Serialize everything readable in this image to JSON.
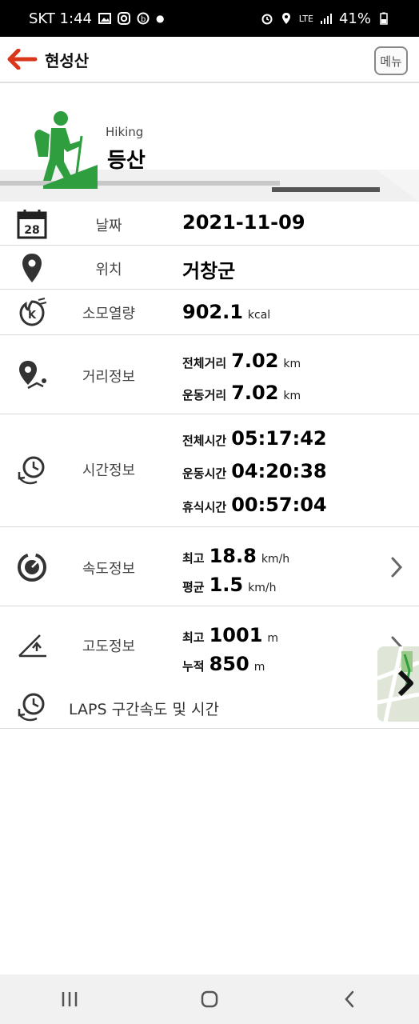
{
  "status": {
    "carrier_time": "SKT 1:44",
    "network": "LTE",
    "battery": "41%"
  },
  "appbar": {
    "title": "현성산",
    "menu_label": "메뉴"
  },
  "activity": {
    "subtitle": "Hiking",
    "title": "등산",
    "icon": "hiker-icon",
    "accent": "#2e9e3e"
  },
  "date": {
    "label": "날짜",
    "value": "2021-11-09",
    "icon_day": "28"
  },
  "location": {
    "label": "위치",
    "value": "거창군"
  },
  "calories": {
    "label": "소모열량",
    "value": "902.1",
    "unit": "kcal"
  },
  "distance": {
    "label": "거리정보",
    "total": {
      "label": "전체거리",
      "value": "7.02",
      "unit": "km"
    },
    "moving": {
      "label": "운동거리",
      "value": "7.02",
      "unit": "km"
    }
  },
  "time": {
    "label": "시간정보",
    "total": {
      "label": "전체시간",
      "value": "05:17:42"
    },
    "moving": {
      "label": "운동시간",
      "value": "04:20:38"
    },
    "rest": {
      "label": "휴식시간",
      "value": "00:57:04"
    }
  },
  "speed": {
    "label": "속도정보",
    "max": {
      "label": "최고",
      "value": "18.8",
      "unit": "km/h"
    },
    "avg": {
      "label": "평균",
      "value": "1.5",
      "unit": "km/h"
    }
  },
  "altitude": {
    "label": "고도정보",
    "max": {
      "label": "최고",
      "value": "1001",
      "unit": "m"
    },
    "cumulative": {
      "label": "누적",
      "value": "850",
      "unit": "m"
    }
  },
  "laps": {
    "label": "LAPS 구간속도 및 시간"
  },
  "accent_color": "#d9361c"
}
